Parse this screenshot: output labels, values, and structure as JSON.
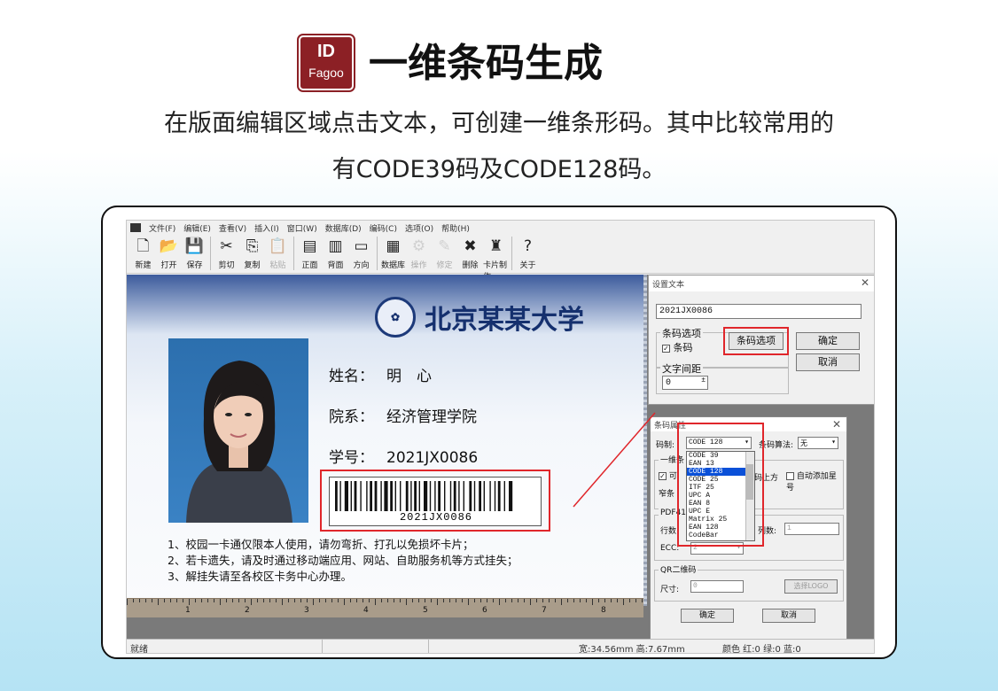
{
  "header": {
    "logo_top": "ID",
    "logo_bottom": "Fagoo",
    "title": "一维条码生成",
    "subtitle_line1": "在版面编辑区域点击文本，可创建一维条形码。其中比较常用的",
    "subtitle_line2": "有CODE39码及CODE128码。"
  },
  "colors": {
    "accent_red": "#e0262b",
    "logo_bg": "#8c2025",
    "card_blue": "#15306e",
    "list_selection": "#0a50d8"
  },
  "menubar": [
    "文件(F)",
    "编辑(E)",
    "查看(V)",
    "插入(I)",
    "窗口(W)",
    "数据库(D)",
    "编码(C)",
    "选项(O)",
    "帮助(H)"
  ],
  "toolbar": [
    {
      "label": "新建",
      "icon": "new-file-icon",
      "glyph": "🗋"
    },
    {
      "label": "打开",
      "icon": "open-folder-icon",
      "glyph": "📂"
    },
    {
      "label": "保存",
      "icon": "save-disk-icon",
      "glyph": "💾"
    },
    {
      "label": "剪切",
      "icon": "cut-icon",
      "glyph": "✂"
    },
    {
      "label": "复制",
      "icon": "copy-icon",
      "glyph": "⎘"
    },
    {
      "label": "粘贴",
      "icon": "paste-icon",
      "glyph": "📋",
      "disabled": true
    },
    {
      "label": "正面",
      "icon": "card-front-icon",
      "glyph": "▤"
    },
    {
      "label": "背面",
      "icon": "card-back-icon",
      "glyph": "▥"
    },
    {
      "label": "方向",
      "icon": "orientation-icon",
      "glyph": "▭"
    },
    {
      "label": "数据库",
      "icon": "database-icon",
      "glyph": "▦"
    },
    {
      "label": "操作",
      "icon": "operate-icon",
      "glyph": "⚙",
      "disabled": true
    },
    {
      "label": "修定",
      "icon": "edit-icon",
      "glyph": "✎",
      "disabled": true
    },
    {
      "label": "删除",
      "icon": "delete-icon",
      "glyph": "✖"
    },
    {
      "label": "卡片制作",
      "icon": "card-make-icon",
      "glyph": "♜"
    },
    {
      "label": "关于",
      "icon": "help-icon",
      "glyph": "?"
    }
  ],
  "card": {
    "school_name": "北京某某大学",
    "name_label": "姓名：",
    "name_value": "明　心",
    "dept_label": "院系：",
    "dept_value": "经济管理学院",
    "id_label": "学号：",
    "id_value": "2021JX0086",
    "barcode_text": "2021JX0086",
    "notes": [
      "1、校园一卡通仅限本人使用，请勿弯折、打孔以免损坏卡片；",
      "2、若卡遗失，请及时通过移动端应用、网站、自助服务机等方式挂失；",
      "3、解挂失请至各校区卡务中心办理。"
    ]
  },
  "ruler_numbers": [
    "1",
    "2",
    "3",
    "4",
    "5",
    "6",
    "7",
    "8"
  ],
  "status": {
    "ready": "就绪",
    "size": "宽:34.56mm 高:7.67mm",
    "color": "颜色 红:0 绿:0 蓝:0"
  },
  "text_dialog": {
    "title": "设置文本",
    "text_value": "2021JX0086",
    "barcode_group": "条码选项",
    "barcode_check": "条码",
    "barcode_options_button": "条码选项",
    "ok": "确定",
    "cancel": "取消",
    "spacing_group": "文字间距",
    "spacing_value": "0"
  },
  "barcode_dialog": {
    "title": "条码属性",
    "code_label": "码制:",
    "code_selected": "CODE 128",
    "algo_label": "条码算法:",
    "algo_value": "无",
    "options": [
      "CODE 39",
      "EAN 13",
      "CODE 128",
      "CODE 25",
      "ITF 25",
      "UPC A",
      "EAN 8",
      "UPC E",
      "Matrix 25",
      "EAN 128",
      "CodeBar"
    ],
    "one_d_group": "一维条",
    "frag_1": "可",
    "frag_2": "码上方",
    "auto_star": "自动添加星号",
    "frag_narrow": "窄条",
    "pdf_group": "PDF417",
    "rows_label": "行数:",
    "cols_label": "列数:",
    "cols_value": "1",
    "ecc_label": "ECC:",
    "ecc_value": "2",
    "qr_group": "QR二维码",
    "size_label": "尺寸:",
    "size_value": "0",
    "logo_button": "选择LOGO",
    "ok": "确定",
    "cancel": "取消"
  }
}
